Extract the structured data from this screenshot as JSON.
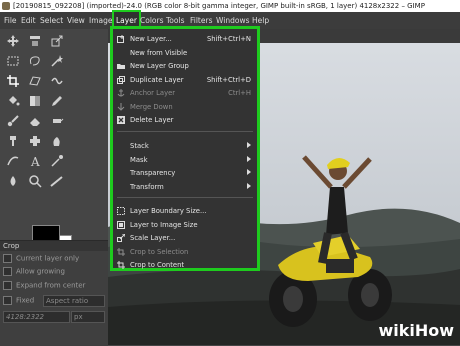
{
  "window": {
    "title": "[20190815_092208] (imported)-24.0 (RGB color 8-bit gamma integer, GIMP built-in sRGB, 1 layer) 4128x2322 – GIMP"
  },
  "menubar": {
    "items": [
      "File",
      "Edit",
      "Select",
      "View",
      "Image",
      "Layer",
      "Colors",
      "Tools",
      "Filters",
      "Windows",
      "Help"
    ],
    "active": "Layer"
  },
  "layer_menu": {
    "items": [
      {
        "label": "New Layer...",
        "shortcut": "Shift+Ctrl+N",
        "icon": "new-layer-icon",
        "enabled": true
      },
      {
        "label": "New from Visible",
        "shortcut": "",
        "icon": "",
        "enabled": true
      },
      {
        "label": "New Layer Group",
        "shortcut": "",
        "icon": "layer-group-icon",
        "enabled": true
      },
      {
        "label": "Duplicate Layer",
        "shortcut": "Shift+Ctrl+D",
        "icon": "duplicate-layer-icon",
        "enabled": true
      },
      {
        "label": "Anchor Layer",
        "shortcut": "Ctrl+H",
        "icon": "anchor-icon",
        "enabled": false
      },
      {
        "label": "Merge Down",
        "shortcut": "",
        "icon": "merge-down-icon",
        "enabled": false
      },
      {
        "label": "Delete Layer",
        "shortcut": "",
        "icon": "delete-layer-icon",
        "enabled": true
      },
      {
        "label": "Stack",
        "submenu": true,
        "enabled": true
      },
      {
        "label": "Mask",
        "submenu": true,
        "enabled": true
      },
      {
        "label": "Transparency",
        "submenu": true,
        "enabled": true
      },
      {
        "label": "Transform",
        "submenu": true,
        "enabled": true
      },
      {
        "label": "Layer Boundary Size...",
        "shortcut": "",
        "icon": "boundary-size-icon",
        "enabled": true
      },
      {
        "label": "Layer to Image Size",
        "shortcut": "",
        "icon": "layer-to-image-icon",
        "enabled": true
      },
      {
        "label": "Scale Layer...",
        "shortcut": "",
        "icon": "scale-layer-icon",
        "enabled": true
      },
      {
        "label": "Crop to Selection",
        "shortcut": "",
        "icon": "crop-icon",
        "enabled": false
      },
      {
        "label": "Crop to Content",
        "shortcut": "",
        "icon": "crop-icon",
        "enabled": true
      }
    ]
  },
  "tool_options": {
    "title": "Crop",
    "options": [
      "Current layer only",
      "Allow growing",
      "Expand from center"
    ],
    "fixed_label": "Fixed",
    "fixed_value": "Aspect ratio",
    "size_value": "4128:2322",
    "unit": "px"
  },
  "colors": {
    "accent": "#1ecb1e",
    "foreground": "#000000",
    "background": "#ffffff"
  },
  "watermark": {
    "part1": "wiki",
    "part2": "How"
  }
}
